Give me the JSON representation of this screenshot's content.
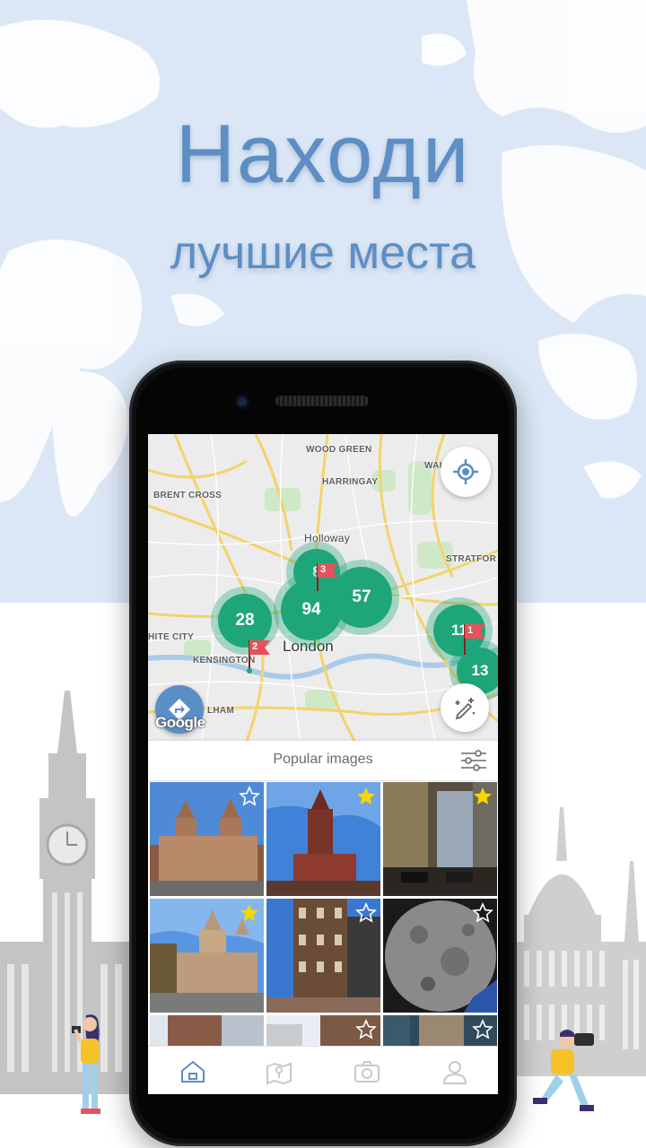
{
  "headline": {
    "title": "Находи",
    "subtitle": "лучшие места"
  },
  "map": {
    "labels": {
      "wood_green": "WOOD GREEN",
      "harringay": "HARRINGAY",
      "brent_cross": "BRENT CROSS",
      "holloway": "Holloway",
      "stratford": "STRATFOR",
      "walthamstow": "WALTH       TOW",
      "white_city": "HITE CITY",
      "kensington": "KENSINGTON",
      "fulham": "LHAM",
      "london": "London"
    },
    "clusters": {
      "c28": "28",
      "c94": "94",
      "c57": "57",
      "c8": "8",
      "c11": "11",
      "c13": "13"
    },
    "flags": {
      "f3": "3",
      "f2": "2",
      "f1": "1"
    },
    "attribution": "Google"
  },
  "popular": {
    "title": "Popular images"
  },
  "images": [
    {
      "subject": "Natural History Museum",
      "favorite": false
    },
    {
      "subject": "St Pancras tower",
      "favorite": true
    },
    {
      "subject": "City street at dusk",
      "favorite": true
    },
    {
      "subject": "Natural History Museum towers",
      "favorite": true
    },
    {
      "subject": "Victorian building",
      "favorite": false
    },
    {
      "subject": "Moon surface",
      "favorite": false
    },
    {
      "subject": "Brick building",
      "favorite": false
    },
    {
      "subject": "Winter street",
      "favorite": false
    },
    {
      "subject": "Statue",
      "favorite": false
    }
  ],
  "tabs": [
    "home",
    "map",
    "camera",
    "profile"
  ],
  "colors": {
    "accent": "#5a8ec6",
    "cluster": "#1ea67a",
    "flag": "#e8505b",
    "star_active": "#f5d800"
  }
}
